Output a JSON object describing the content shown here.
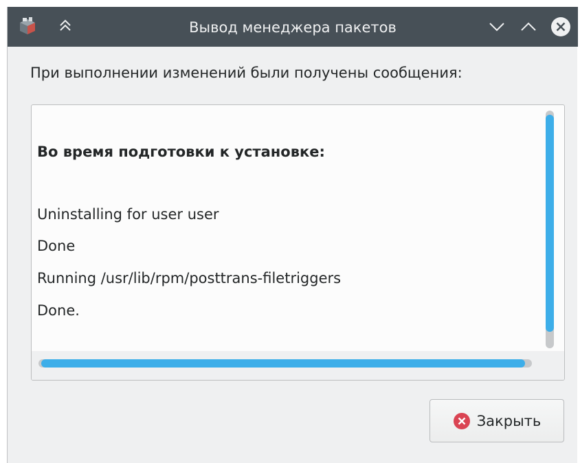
{
  "window": {
    "title": "Вывод менеджера пакетов"
  },
  "dialog": {
    "heading": "При выполнении изменений были получены сообщения:",
    "log": {
      "section_title": "Во время подготовки к установке:",
      "lines": [
        "Uninstalling for user user",
        "Done",
        "Running /usr/lib/rpm/posttrans-filetriggers",
        "Done."
      ]
    },
    "close_button_label": "Закрыть"
  },
  "icons": {
    "app": "package-manager-icon",
    "keep_above": "double-chevron-up-icon",
    "minimize": "chevron-down-icon",
    "maximize": "chevron-up-icon",
    "close": "close-circle-icon",
    "close_button": "error-circle-icon"
  },
  "colors": {
    "titlebar": "#475057",
    "window_bg": "#eff0f1",
    "accent": "#3daee9",
    "close_red": "#da4453"
  }
}
